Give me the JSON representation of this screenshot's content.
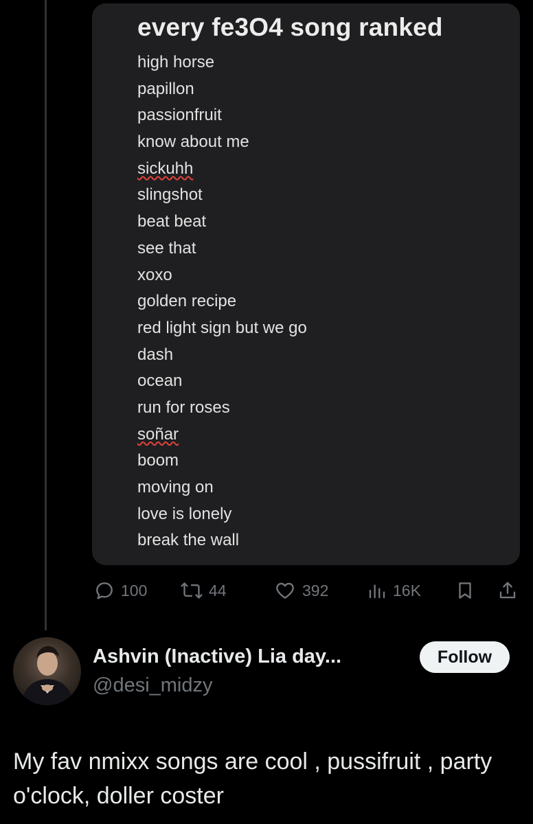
{
  "note": {
    "title": "every fe3O4 song ranked",
    "songs": [
      "high horse",
      "papillon",
      "passionfruit",
      "know about me",
      "sickuhh",
      "slingshot",
      "beat beat",
      "see that",
      "xoxo",
      "golden recipe",
      "red light sign but we go",
      "dash",
      "ocean",
      "run for roses",
      "soñar",
      "boom",
      "moving on",
      "love is lonely",
      "break the wall"
    ]
  },
  "actions": {
    "replies": "100",
    "reposts": "44",
    "likes": "392",
    "views": "16K"
  },
  "author": {
    "name": "Ashvin (Inactive) Lia day...",
    "handle": "@desi_midzy",
    "follow_label": "Follow"
  },
  "post": {
    "text": "My fav nmixx songs are cool , pussifruit , party o'clock, doller coster"
  },
  "colors": {
    "background": "#000000",
    "card": "#1f1f21",
    "muted": "#71767b",
    "text": "#e7e9ea",
    "follow_bg": "#eff3f4"
  },
  "icons": [
    "reply-icon",
    "repost-icon",
    "like-icon",
    "views-icon",
    "bookmark-icon",
    "share-icon"
  ]
}
